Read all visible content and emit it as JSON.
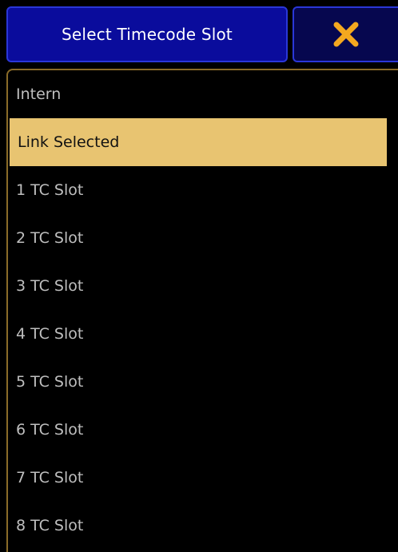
{
  "dialog": {
    "title": "Select Timecode Slot",
    "close_icon": "close-x-icon",
    "accent_color": "#f4a81f"
  },
  "list": {
    "selected_index": 1,
    "items": [
      {
        "label": "Intern"
      },
      {
        "label": "Link Selected"
      },
      {
        "label": "1 TC Slot"
      },
      {
        "label": "2 TC Slot"
      },
      {
        "label": "3 TC Slot"
      },
      {
        "label": "4 TC Slot"
      },
      {
        "label": "5 TC Slot"
      },
      {
        "label": "6 TC Slot"
      },
      {
        "label": "7 TC Slot"
      },
      {
        "label": "8 TC Slot"
      }
    ]
  },
  "colors": {
    "title_bg": "#0a0c9c",
    "selected_bg": "#e8c471",
    "panel_border": "#8a6b28"
  }
}
